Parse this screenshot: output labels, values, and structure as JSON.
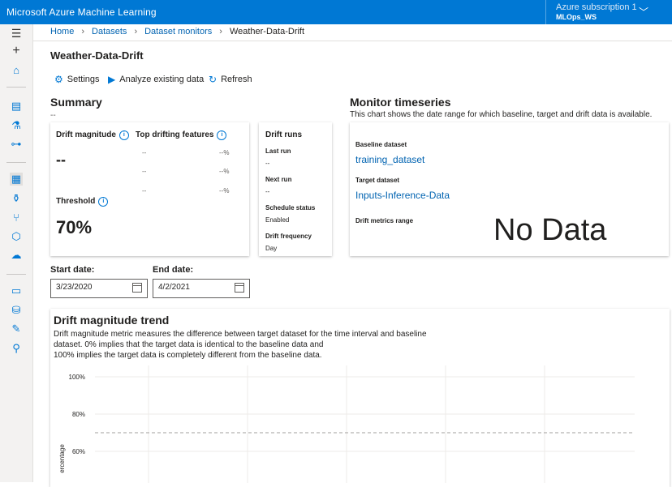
{
  "app": {
    "title": "Microsoft Azure Machine Learning",
    "subscription": "Azure subscription 1",
    "workspace": "MLOps_WS"
  },
  "breadcrumb": [
    "Home",
    "Datasets",
    "Dataset monitors",
    "Weather-Data-Drift"
  ],
  "page": {
    "title": "Weather-Data-Drift"
  },
  "toolbar": {
    "settings": "Settings",
    "analyze": "Analyze existing data",
    "refresh": "Refresh"
  },
  "summary": {
    "title": "Summary",
    "subtitle": "--",
    "drift_magnitude_label": "Drift magnitude",
    "drift_magnitude_value": "--",
    "top_features_label": "Top drifting features",
    "features": [
      {
        "name": "--",
        "value": "--%"
      },
      {
        "name": "--",
        "value": "--%"
      },
      {
        "name": "--",
        "value": "--%"
      }
    ],
    "threshold_label": "Threshold",
    "threshold_value": "70%"
  },
  "drift_runs": {
    "title": "Drift runs",
    "last_run_label": "Last run",
    "last_run_value": "--",
    "next_run_label": "Next run",
    "next_run_value": "--",
    "schedule_label": "Schedule status",
    "schedule_value": "Enabled",
    "frequency_label": "Drift frequency",
    "frequency_value": "Day"
  },
  "timeseries": {
    "title": "Monitor timeseries",
    "description": "This chart shows the date range for which baseline, target and drift data is available.",
    "baseline_label": "Baseline dataset",
    "baseline_value": "training_dataset",
    "target_label": "Target dataset",
    "target_value": "Inputs-Inference-Data",
    "range_label": "Drift metrics range",
    "no_data": "No Data"
  },
  "dates": {
    "start_label": "Start date:",
    "start_value": "3/23/2020",
    "end_label": "End date:",
    "end_value": "4/2/2021"
  },
  "trend": {
    "title": "Drift magnitude trend",
    "description_lines": [
      "Drift magnitude metric measures the difference between target dataset for the time interval and baseline",
      "dataset. 0% implies that the target data is identical to the baseline data and",
      "100% implies the target data is completely different from the baseline data."
    ]
  },
  "chart_data": {
    "type": "line",
    "title": "",
    "ylabel": "ercentage",
    "ylim": [
      0,
      100
    ],
    "yticks": [
      "100%",
      "80%",
      "60%"
    ],
    "series": [],
    "threshold": 70,
    "grid": true
  },
  "colors": {
    "brand": "#0078d4",
    "link": "#0063b1"
  },
  "icons": {
    "sidebar": [
      "menu-icon",
      "plus-icon",
      "home-icon",
      "notebook-icon",
      "automl-icon",
      "designer-icon",
      "datasets-icon",
      "experiments-icon",
      "pipelines-icon",
      "models-icon",
      "endpoints-icon",
      "compute-icon",
      "datastores-icon",
      "labeling-icon",
      "linked-services-icon"
    ]
  }
}
